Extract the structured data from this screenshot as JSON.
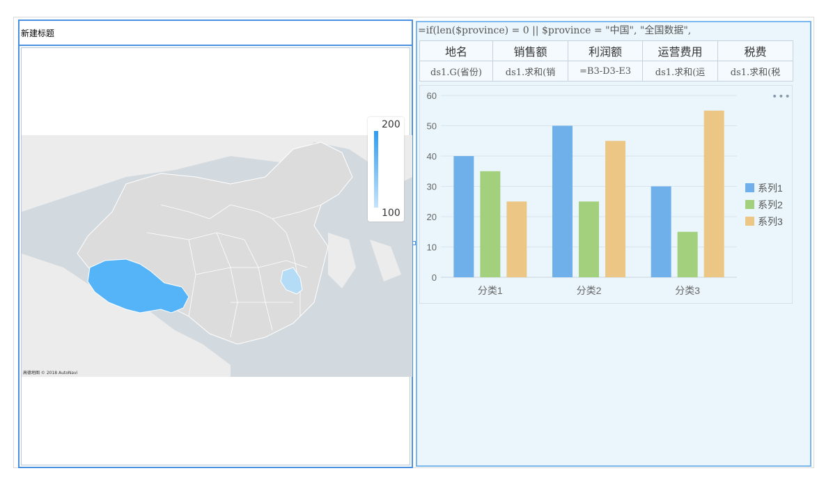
{
  "map_widget": {
    "title": "新建标题",
    "legend_max": "200",
    "legend_min": "100",
    "copyright": "高德地图 © 2018 AutoNavi"
  },
  "report_widget": {
    "formula": "=if(len($province) = 0 || $province = \"中国\", \"全国数据\",",
    "headers": [
      "地名",
      "销售额",
      "利润额",
      "运营费用",
      "税费"
    ],
    "cells": [
      "ds1.G(省份)",
      "ds1.求和(销",
      "=B3-D3-E3",
      "ds1.求和(运",
      "ds1.求和(税"
    ]
  },
  "chart_data": {
    "type": "bar",
    "categories": [
      "分类1",
      "分类2",
      "分类3"
    ],
    "series": [
      {
        "name": "系列1",
        "values": [
          40,
          50,
          30
        ],
        "color": "#6fb0ea"
      },
      {
        "name": "系列2",
        "values": [
          35,
          25,
          15
        ],
        "color": "#a3d07d"
      },
      {
        "name": "系列3",
        "values": [
          25,
          45,
          55
        ],
        "color": "#ecc684"
      }
    ],
    "ylim": [
      0,
      60
    ],
    "yticks": [
      "0",
      "10",
      "20",
      "30",
      "40",
      "50",
      "60"
    ],
    "legend_position": "right",
    "grid": true
  }
}
